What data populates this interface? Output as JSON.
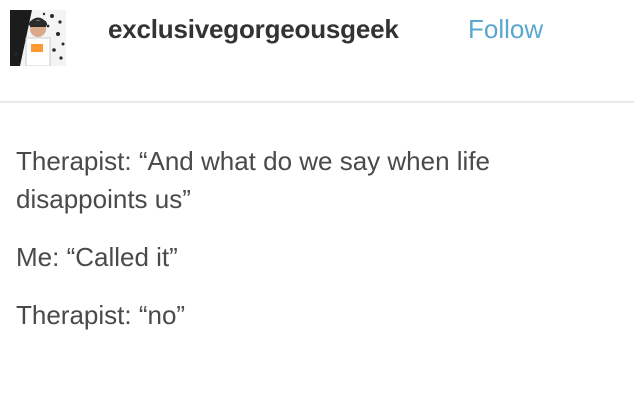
{
  "header": {
    "username": "exclusivegorgeousgeek",
    "follow_label": "Follow"
  },
  "post": {
    "lines": [
      "Therapist: “And what do we say when life disappoints us”",
      "Me: “Called it”",
      "Therapist: “no”"
    ]
  },
  "colors": {
    "follow_link": "#5aa7cf",
    "username": "#333333",
    "body_text": "#4a4a4a",
    "divider": "#e9e9e9"
  }
}
